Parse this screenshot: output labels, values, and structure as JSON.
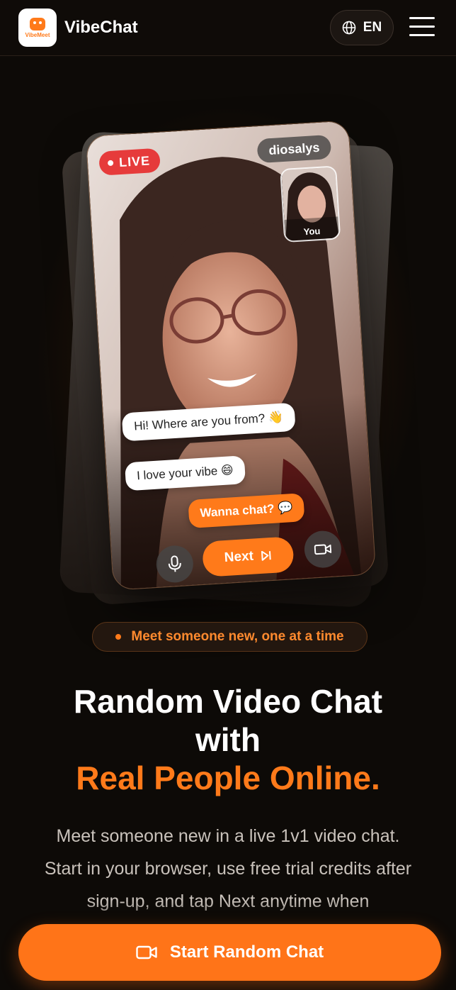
{
  "header": {
    "logo_text": "VibeMeet",
    "brand": "VibeChat",
    "language": "EN"
  },
  "preview_card": {
    "live_label": "LIVE",
    "username": "diosalys",
    "self_label": "You",
    "messages": [
      "Hi! Where are you from? 👋",
      "I love your vibe 😄",
      "Wanna chat? 💬"
    ],
    "next_label": "Next"
  },
  "hero": {
    "tagline": "Meet someone new, one at a time",
    "title_line1": "Random Video Chat",
    "title_line2": "with",
    "title_accent": "Real People Online.",
    "description": "Meet someone new in a live 1v1 video chat. Start in your browser, use free trial credits after sign-up, and tap Next anytime when"
  },
  "cta": {
    "label": "Start Random Chat"
  },
  "colors": {
    "accent": "#ff7a1a",
    "live": "#e63b3b",
    "background": "#0d0a07"
  },
  "icons": [
    "globe-icon",
    "menu-icon",
    "microphone-icon",
    "skip-next-icon",
    "video-camera-icon"
  ]
}
